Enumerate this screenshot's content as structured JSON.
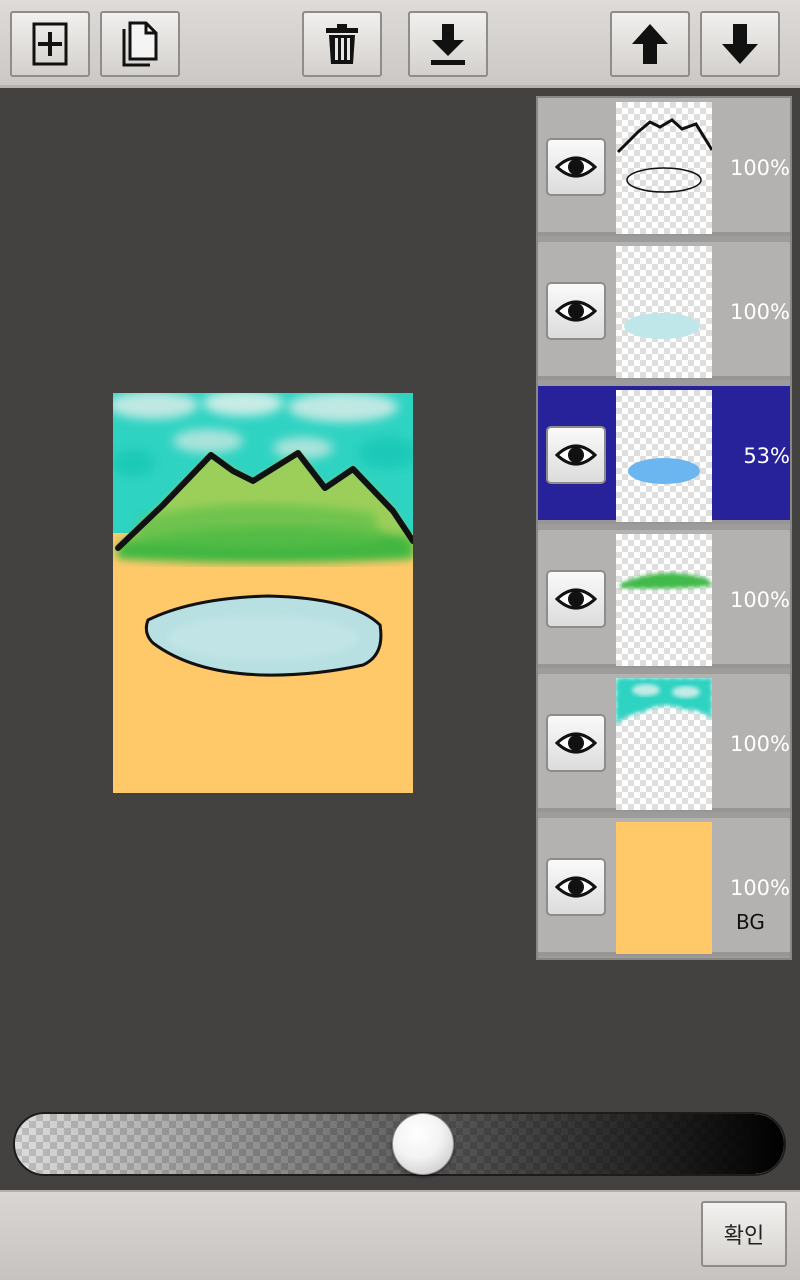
{
  "toolbar": {
    "icons": [
      "add-layer-icon",
      "duplicate-layer-icon",
      "delete-layer-icon",
      "merge-down-icon",
      "move-up-icon",
      "move-down-icon"
    ]
  },
  "layers": [
    {
      "opacity": "100%",
      "thumb": "outline-icon",
      "active": false
    },
    {
      "opacity": "100%",
      "thumb": "light-blue-pond",
      "active": false
    },
    {
      "opacity": "53%",
      "thumb": "blue-pond",
      "active": true
    },
    {
      "opacity": "100%",
      "thumb": "green-grass",
      "active": false
    },
    {
      "opacity": "100%",
      "thumb": "teal-sky",
      "active": false
    },
    {
      "opacity": "100%",
      "thumb": "orange-background",
      "active": false,
      "label": "BG"
    }
  ],
  "slider": {
    "value": 0.53
  },
  "confirm_label": "확인",
  "colors": {
    "active_layer": "#28229a",
    "background_fill": "#ffc96a",
    "workspace": "#444241"
  }
}
